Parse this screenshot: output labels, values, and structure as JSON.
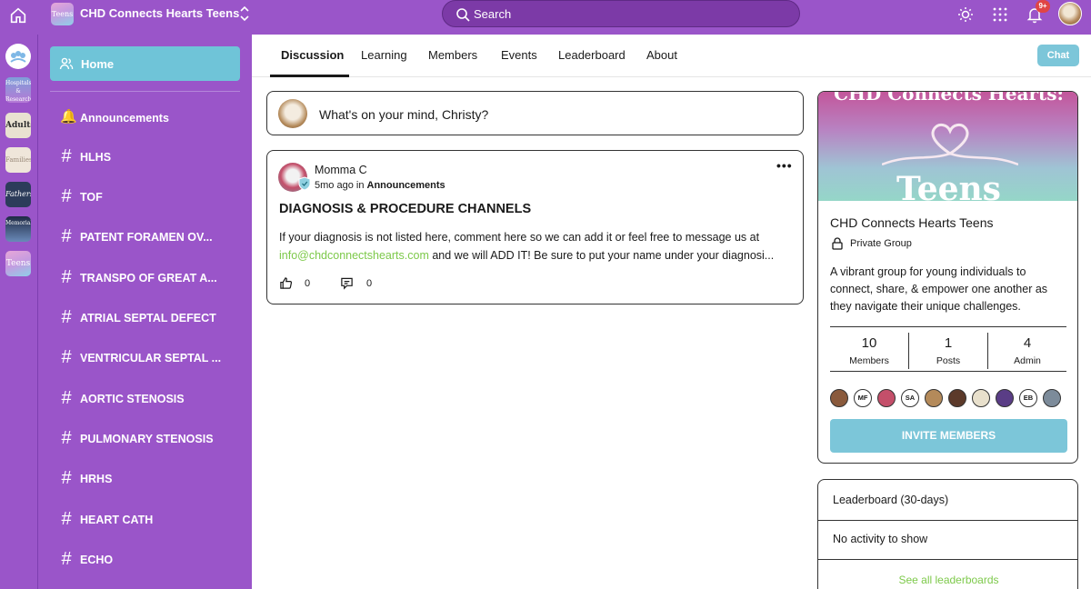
{
  "topbar": {
    "group_thumb_text": "Teens",
    "group_name": "CHD Connects Hearts Teens",
    "search_placeholder": "Search",
    "notifications_badge": "9+"
  },
  "rail": {
    "items": [
      {
        "label": "",
        "icon": "community-logo-icon"
      },
      {
        "label": "Hospitals & Research"
      },
      {
        "label": "Adults"
      },
      {
        "label": "Families"
      },
      {
        "label": "Fathers"
      },
      {
        "label": "Memorial"
      },
      {
        "label": "Teens"
      }
    ]
  },
  "sidebar": {
    "home_label": "Home",
    "announcements_label": "Announcements",
    "channels": [
      "HLHS",
      "TOF",
      "PATENT FORAMEN OV...",
      "TRANSPO OF GREAT A...",
      "ATRIAL SEPTAL DEFECT",
      "VENTRICULAR SEPTAL ...",
      "AORTIC STENOSIS",
      "PULMONARY STENOSIS",
      "HRHS",
      "HEART CATH",
      "ECHO"
    ]
  },
  "tabs": [
    "Discussion",
    "Learning",
    "Members",
    "Events",
    "Leaderboard",
    "About"
  ],
  "active_tab": "Discussion",
  "chat_label": "Chat",
  "composer": {
    "placeholder": "What's on your mind, Christy?"
  },
  "post": {
    "author": "Momma C",
    "time": "5mo ago",
    "in_word": "in",
    "channel": "Announcements",
    "title": "DIAGNOSIS & PROCEDURE CHANNELS",
    "body_line1": "If your diagnosis is not listed here, comment here so we can add it or feel free to message us at",
    "body_link": "info@chdconnectshearts.com",
    "body_line2_rest": " and we will ADD IT! Be sure to put your name under your diagnosi...",
    "likes": "0",
    "comments": "0"
  },
  "about": {
    "cover_top_text": "CHD Connects Hearts:",
    "cover_bottom_text": "Teens",
    "group_name": "CHD Connects Hearts Teens",
    "privacy": "Private Group",
    "description": "A vibrant group for young individuals to connect, share, & empower one another as they navigate their unique challenges.",
    "stats": [
      {
        "num": "10",
        "label": "Members"
      },
      {
        "num": "1",
        "label": "Posts"
      },
      {
        "num": "4",
        "label": "Admin"
      }
    ],
    "member_avatars": [
      {
        "initials": "",
        "color": "#8a5a3c"
      },
      {
        "initials": "MF",
        "color": "#ffffff"
      },
      {
        "initials": "",
        "color": "#c44f6a"
      },
      {
        "initials": "SA",
        "color": "#ffffff"
      },
      {
        "initials": "",
        "color": "#b48a5a"
      },
      {
        "initials": "",
        "color": "#5c3a2a"
      },
      {
        "initials": "",
        "color": "#e8e0cc"
      },
      {
        "initials": "",
        "color": "#5a3d86"
      },
      {
        "initials": "EB",
        "color": "#ffffff"
      },
      {
        "initials": "",
        "color": "#7c8b9a"
      }
    ],
    "invite_label": "INVITE MEMBERS"
  },
  "leaderboard": {
    "title": "Leaderboard (30-days)",
    "empty": "No activity to show",
    "see_all": "See all leaderboards"
  },
  "colors": {
    "brand_purple": "#9a55c9",
    "accent_teal": "#7cc6d9",
    "link_green": "#7dc94a"
  }
}
